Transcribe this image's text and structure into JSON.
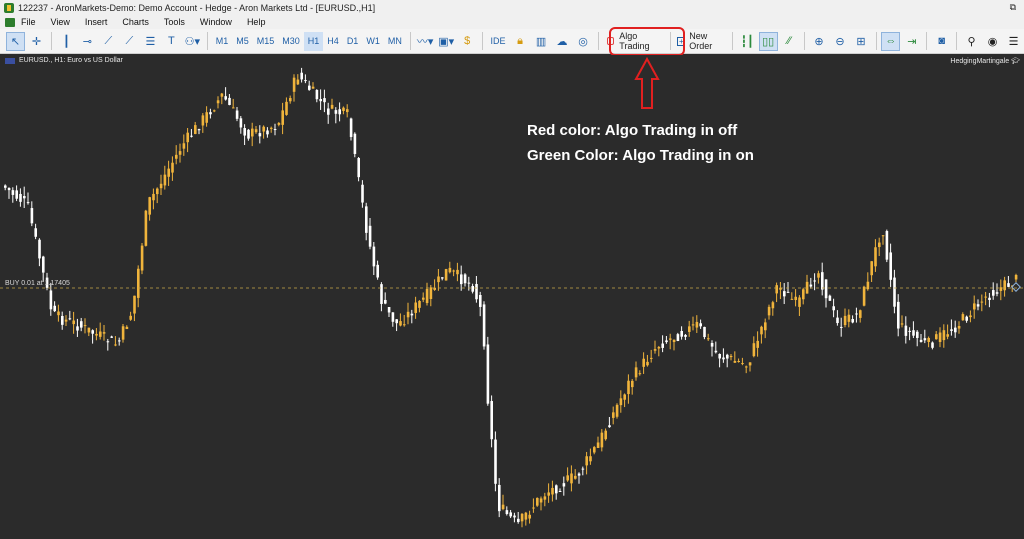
{
  "window": {
    "title": "122237 - AronMarkets-Demo: Demo Account - Hedge - Aron Markets Ltd - [EURUSD.,H1]"
  },
  "menu": [
    "File",
    "View",
    "Insert",
    "Charts",
    "Tools",
    "Window",
    "Help"
  ],
  "timeframes": [
    "M1",
    "M5",
    "M15",
    "M30",
    "H1",
    "H4",
    "D1",
    "W1",
    "MN"
  ],
  "selected_timeframe": "H1",
  "toolbar": {
    "ide_label": "IDE",
    "algo_label": "Algo Trading",
    "new_order_label": "New Order"
  },
  "chart": {
    "symbol_label": "EURUSD., H1:  Euro vs US Dollar",
    "ea_name": "HedgingMartingale",
    "position_label": "BUY 0.01 at 1.17405",
    "colors": {
      "bull": "#f0b43c",
      "bear": "#ffffff",
      "background": "#2b2b2b",
      "position_line": "#c8a84a"
    }
  },
  "annotation": {
    "line1": "Red color: Algo Trading in off",
    "line2": "Green  Color: Algo Trading in on",
    "highlight_color": "#e02020"
  }
}
